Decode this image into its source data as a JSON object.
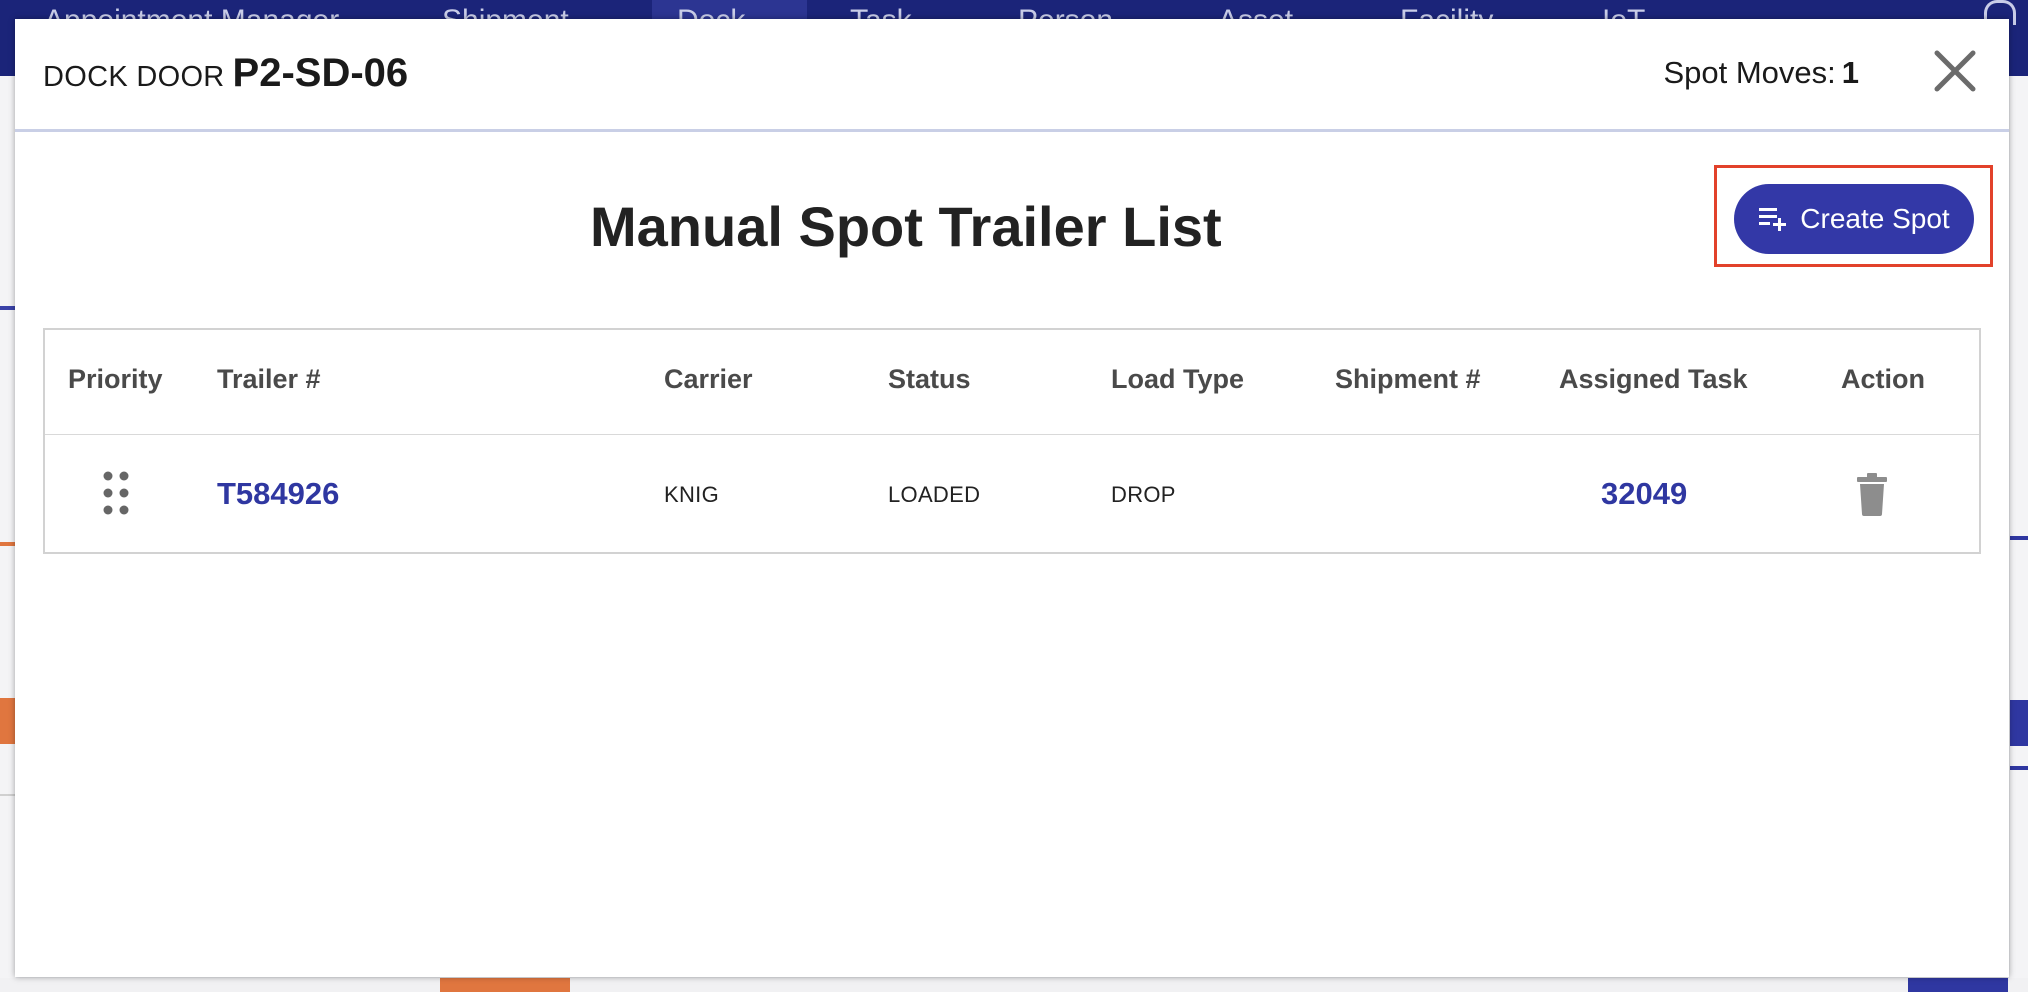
{
  "background_app": {
    "nav_items": [
      "Appointment Manager",
      "Shipment",
      "Dock",
      "Task",
      "Person",
      "Asset",
      "Facility",
      "IoT"
    ],
    "nav_active": "Dock"
  },
  "modal": {
    "title_prefix": "DOCK DOOR",
    "title_code": "P2-SD-06",
    "spot_moves_label": "Spot Moves:",
    "spot_moves_count": "1",
    "list_title": "Manual Spot Trailer List",
    "create_button_label": "Create Spot",
    "table": {
      "headers": [
        "Priority",
        "Trailer #",
        "Carrier",
        "Status",
        "Load Type",
        "Shipment #",
        "Assigned Task",
        "Action"
      ],
      "rows": [
        {
          "trailer": "T584926",
          "carrier": "KNIG",
          "status": "LOADED",
          "load_type": "DROP",
          "shipment": "",
          "assigned_task": "32049"
        }
      ]
    }
  },
  "colors": {
    "nav_bg": "#1b2479",
    "primary": "#3338a7",
    "link": "#2f37a1",
    "highlight": "#e2412a"
  },
  "icons": {
    "close": "close-icon",
    "create": "playlist-add-icon",
    "drag": "drag-handle-icon",
    "delete": "trash-icon"
  }
}
